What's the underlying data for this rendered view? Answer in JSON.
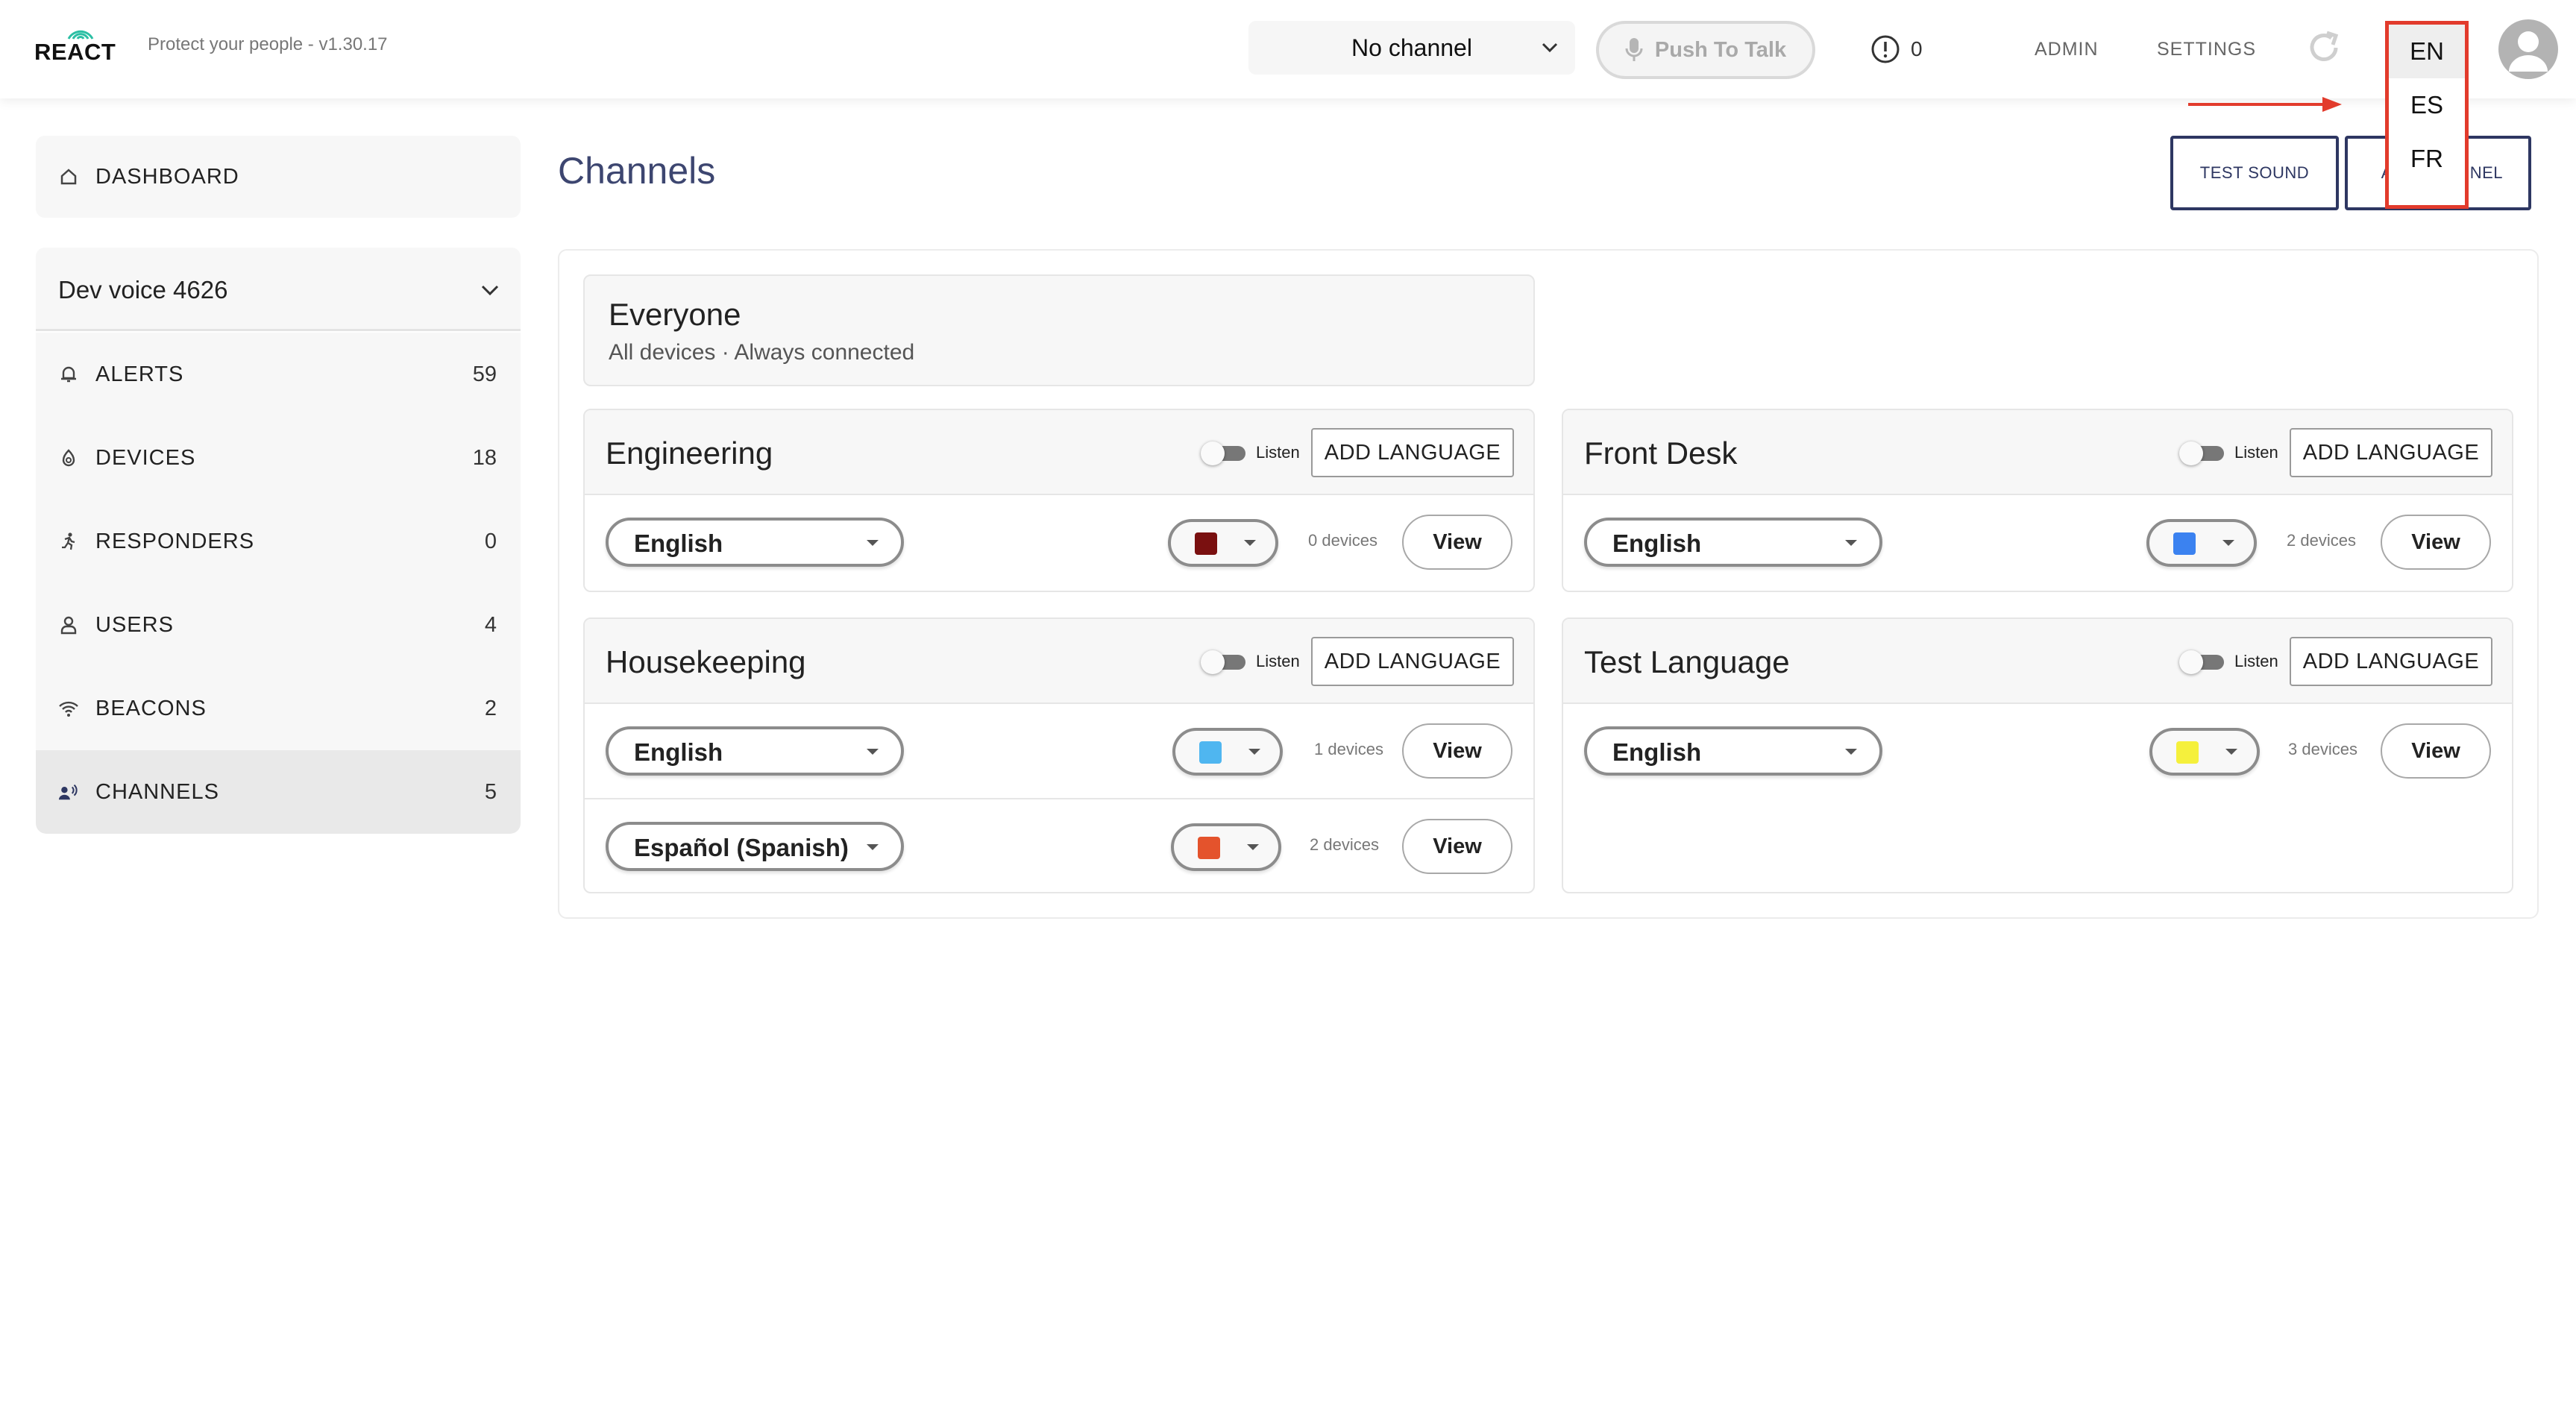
{
  "header": {
    "logo_text": "REACT",
    "tagline": "Protect your people - v1.30.17",
    "channel_select": "No channel",
    "push_to_talk": "Push To Talk",
    "alert_count": "0",
    "admin": "ADMIN",
    "settings": "SETTINGS",
    "language_menu": [
      "EN",
      "ES",
      "FR"
    ],
    "language_selected": "EN",
    "annotation_color": "#e23b2c"
  },
  "sidebar": {
    "dashboard": "DASHBOARD",
    "org": "Dev voice 4626",
    "items": [
      {
        "label": "ALERTS",
        "count": "59",
        "icon": "bell-icon"
      },
      {
        "label": "DEVICES",
        "count": "18",
        "icon": "device-icon"
      },
      {
        "label": "RESPONDERS",
        "count": "0",
        "icon": "running-person-icon"
      },
      {
        "label": "USERS",
        "count": "4",
        "icon": "user-icon"
      },
      {
        "label": "BEACONS",
        "count": "2",
        "icon": "wifi-icon"
      },
      {
        "label": "CHANNELS",
        "count": "5",
        "icon": "channels-icon"
      }
    ]
  },
  "main": {
    "title": "Channels",
    "test_sound": "TEST SOUND",
    "add_channel": "ADD CHANNEL",
    "everyone": {
      "title": "Everyone",
      "subtitle": "All devices · Always connected"
    },
    "listen_label": "Listen",
    "add_language_label": "ADD LANGUAGE",
    "view_label": "View",
    "channels": [
      {
        "name": "Engineering",
        "rows": [
          {
            "language": "English",
            "color": "#7a1010",
            "devices": "0 devices"
          }
        ]
      },
      {
        "name": "Front Desk",
        "rows": [
          {
            "language": "English",
            "color": "#3b82f0",
            "devices": "2 devices"
          }
        ]
      },
      {
        "name": "Housekeeping",
        "rows": [
          {
            "language": "English",
            "color": "#4fb6f0",
            "devices": "1 devices"
          },
          {
            "language": "Español (Spanish)",
            "color": "#e4532c",
            "devices": "2 devices"
          }
        ]
      },
      {
        "name": "Test Language",
        "rows": [
          {
            "language": "English",
            "color": "#f5f03c",
            "devices": "3 devices"
          }
        ]
      }
    ]
  }
}
